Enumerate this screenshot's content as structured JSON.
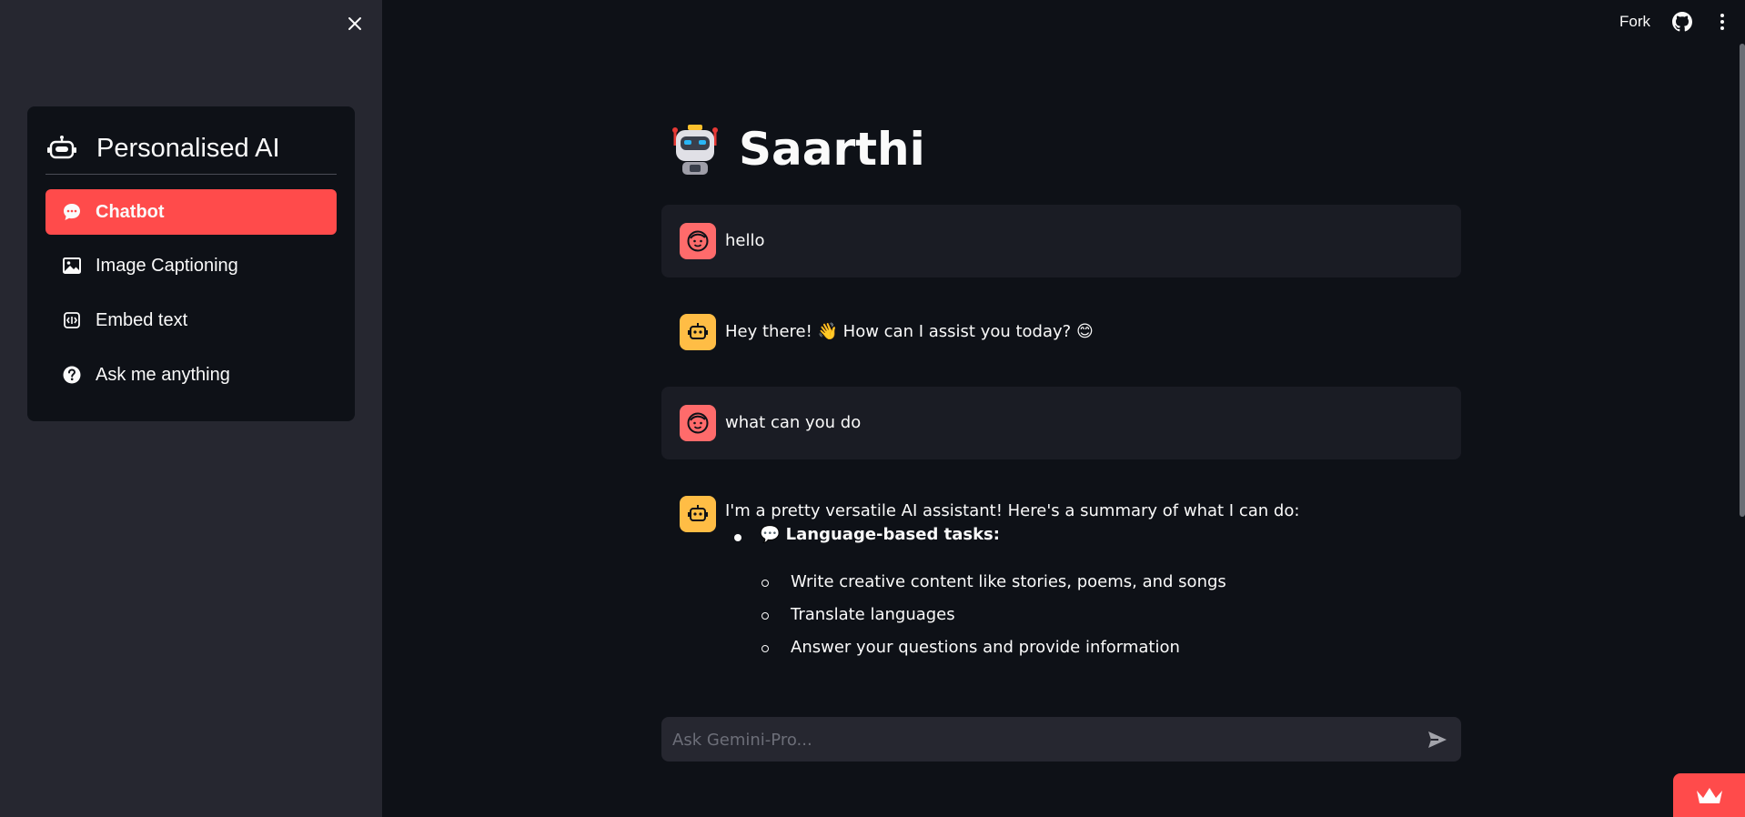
{
  "sidebar": {
    "close_icon": "close-icon",
    "menu_title": "Personalised AI",
    "items": [
      {
        "label": "Chatbot",
        "icon": "chat-bubble-icon",
        "active": true
      },
      {
        "label": "Image Captioning",
        "icon": "image-icon",
        "active": false
      },
      {
        "label": "Embed text",
        "icon": "embed-icon",
        "active": false
      },
      {
        "label": "Ask me anything",
        "icon": "question-icon",
        "active": false
      }
    ]
  },
  "topbar": {
    "fork_label": "Fork",
    "github_icon": "github-icon",
    "menu_icon": "kebab-menu-icon"
  },
  "main": {
    "title": "Saarthi",
    "title_icon": "robot-icon",
    "messages": [
      {
        "role": "user",
        "text": "hello"
      },
      {
        "role": "assistant",
        "text": "Hey there! 👋 How can I assist you today? 😊"
      },
      {
        "role": "user",
        "text": "what can you do"
      },
      {
        "role": "assistant",
        "text": "I'm a pretty versatile AI assistant! Here's a summary of what I can do:"
      }
    ],
    "reply_list": {
      "heading": "💬 Language-based tasks:",
      "items": [
        "Write creative content like stories, poems, and songs",
        "Translate languages",
        "Answer your questions and provide information"
      ]
    }
  },
  "chat_input": {
    "placeholder": "Ask Gemini-Pro..."
  },
  "colors": {
    "accent": "#ff4b4b",
    "background": "#0e1117",
    "sidebar": "#262730",
    "user_avatar": "#ff6b6b",
    "bot_avatar": "#ffbd45"
  }
}
